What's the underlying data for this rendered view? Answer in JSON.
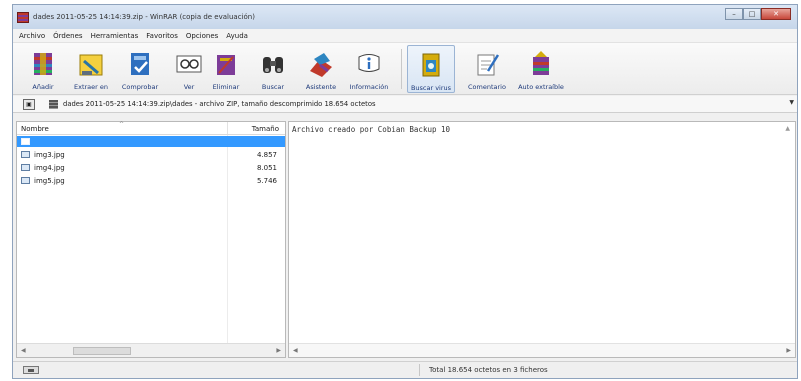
{
  "window": {
    "title": "dades 2011-05-25 14:14:39.zip - WinRAR (copia de evaluación)"
  },
  "menu": [
    "Archivo",
    "Órdenes",
    "Herramientas",
    "Favoritos",
    "Opciones",
    "Ayuda"
  ],
  "toolbar": [
    {
      "label": "Añadir",
      "icon": "add-archive-icon"
    },
    {
      "label": "Extraer en",
      "icon": "extract-to-icon"
    },
    {
      "label": "Comprobar",
      "icon": "test-icon"
    },
    {
      "label": "Ver",
      "icon": "view-icon"
    },
    {
      "label": "Eliminar",
      "icon": "delete-icon"
    },
    {
      "label": "Buscar",
      "icon": "find-icon"
    },
    {
      "label": "Asistente",
      "icon": "wizard-icon"
    },
    {
      "label": "Información",
      "icon": "info-icon"
    },
    {
      "label": "Buscar virus",
      "icon": "virus-scan-icon"
    },
    {
      "label": "Comentario",
      "icon": "comment-icon"
    },
    {
      "label": "Auto extraíble",
      "icon": "sfx-icon"
    }
  ],
  "address": {
    "path": "dades 2011-05-25 14:14:39.zip\\dades - archivo ZIP, tamaño descomprimido 18.654 octetos"
  },
  "file_list": {
    "columns": {
      "name": "Nombre",
      "size": "Tamaño"
    },
    "rows": [
      {
        "name": "",
        "size": "",
        "selected": true
      },
      {
        "name": "img3.jpg",
        "size": "4.857"
      },
      {
        "name": "img4.jpg",
        "size": "8.051"
      },
      {
        "name": "img5.jpg",
        "size": "5.746"
      }
    ]
  },
  "comment": {
    "text": "Archivo creado por Cobian Backup 10"
  },
  "status": {
    "text": "Total 18.654 octetos en 3 ficheros"
  },
  "colors": {
    "selection": "#3399ff",
    "toolbar_text": "#1e3a7a"
  }
}
